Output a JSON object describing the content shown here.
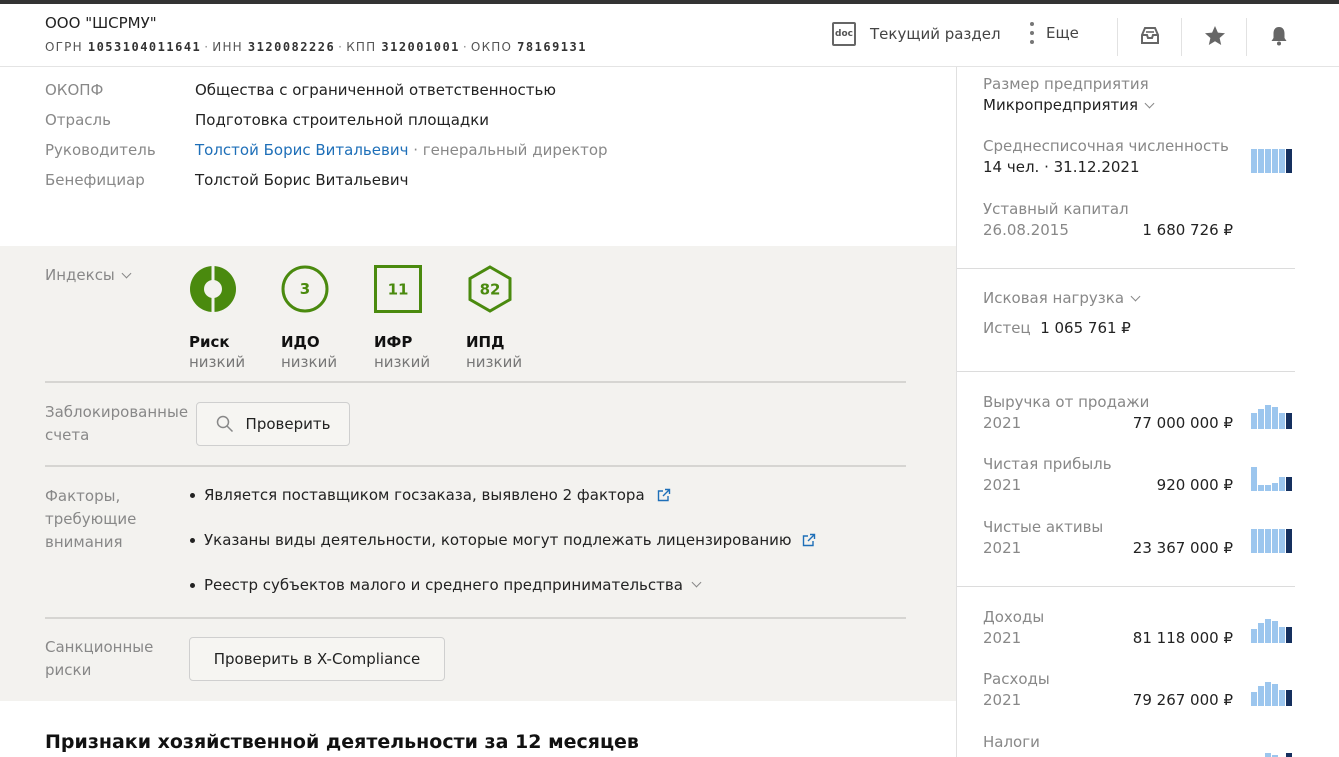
{
  "header": {
    "company_name": "ООО \"ШСРМУ\"",
    "codes": [
      {
        "label": "ОГРН",
        "value": "1053104011641"
      },
      {
        "label": "ИНН",
        "value": "3120082226"
      },
      {
        "label": "КПП",
        "value": "312001001"
      },
      {
        "label": "ОКПО",
        "value": "78169131"
      }
    ],
    "doc_icon_text": "doc",
    "current_section_label": "Текущий раздел",
    "more_label": "Еще"
  },
  "info": {
    "okopf_label": "ОКОПФ",
    "okopf_value": "Общества с ограниченной ответственностью",
    "industry_label": "Отрасль",
    "industry_value": "Подготовка строительной площадки",
    "head_label": "Руководитель",
    "head_name": "Толстой Борис Витальевич",
    "head_role": " · генеральный директор",
    "beneficiary_label": "Бенефициар",
    "beneficiary_name": "Толстой Борис Витальевич"
  },
  "indexes": {
    "label": "Индексы",
    "items": [
      {
        "name": "Риск",
        "level": "низкий",
        "value": ""
      },
      {
        "name": "ИДО",
        "level": "низкий",
        "value": "3"
      },
      {
        "name": "ИФР",
        "level": "низкий",
        "value": "11"
      },
      {
        "name": "ИПД",
        "level": "низкий",
        "value": "82"
      }
    ],
    "accent_color": "#4a8a0e"
  },
  "blocked": {
    "label": "Заблокированные счета",
    "button": "Проверить"
  },
  "factors": {
    "label": "Факторы, требующие внимания",
    "items": [
      "Является поставщиком госзаказа, выявлено 2 фактора",
      "Указаны виды деятельности, которые могут подлежать лицензированию",
      "Реестр субъектов малого и среднего предпринимательства"
    ]
  },
  "sanctions": {
    "label": "Санкционные риски",
    "button": "Проверить в X-Compliance"
  },
  "bottom_title": "Признаки хозяйственной деятельности за 12 месяцев",
  "sidebar": {
    "size_title": "Размер предприятия",
    "size_value": "Микропредприятия",
    "headcount_title": "Среднесписочная численность",
    "headcount_value": "14 чел. · 31.12.2021",
    "capital_title": "Уставный капитал",
    "capital_date": "26.08.2015",
    "capital_value": "1 680 726 ₽",
    "claims_title": "Исковая нагрузка",
    "claims_label": "Истец",
    "claims_value": "1 065 761 ₽",
    "revenue_title": "Выручка от продажи",
    "revenue_year": "2021",
    "revenue_value": "77 000 000 ₽",
    "profit_title": "Чистая прибыль",
    "profit_year": "2021",
    "profit_value": "920 000 ₽",
    "assets_title": "Чистые активы",
    "assets_year": "2021",
    "assets_value": "23 367 000 ₽",
    "income_title": "Доходы",
    "income_year": "2021",
    "income_value": "81 118 000 ₽",
    "expenses_title": "Расходы",
    "expenses_year": "2021",
    "expenses_value": "79 267 000 ₽",
    "taxes_title": "Налоги"
  },
  "colors": {
    "link": "#1e6fb8",
    "spark_light": "#9cc6ee",
    "spark_dark": "#15305f"
  }
}
